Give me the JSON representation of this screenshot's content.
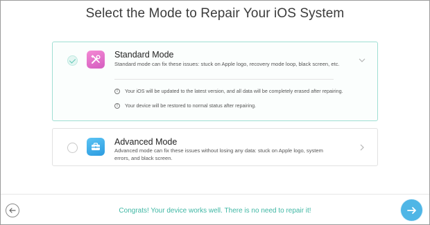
{
  "page": {
    "title": "Select the Mode to Repair Your iOS System"
  },
  "modes": [
    {
      "title": "Standard Mode",
      "description": "Standard mode can fix these issues: stuck on Apple logo, recovery mode loop, black screen, etc.",
      "selected": true,
      "icon": "tools-icon",
      "notes": [
        "Your iOS will be updated to the latest version, and all data will be completely erased after repairing.",
        "Your device will be restored to normal status after repairing."
      ]
    },
    {
      "title": "Advanced Mode",
      "description": "Advanced mode can fix these issues without losing any data: stuck on Apple logo, system errors, and black screen.",
      "selected": false,
      "icon": "toolbox-icon"
    }
  ],
  "footer": {
    "message": "Congrats! Your device works well. There is no need to repair it!"
  },
  "colors": {
    "accent": "#3fb7a4",
    "next_button": "#4fb6e6",
    "selected_border": "#9fded3"
  }
}
